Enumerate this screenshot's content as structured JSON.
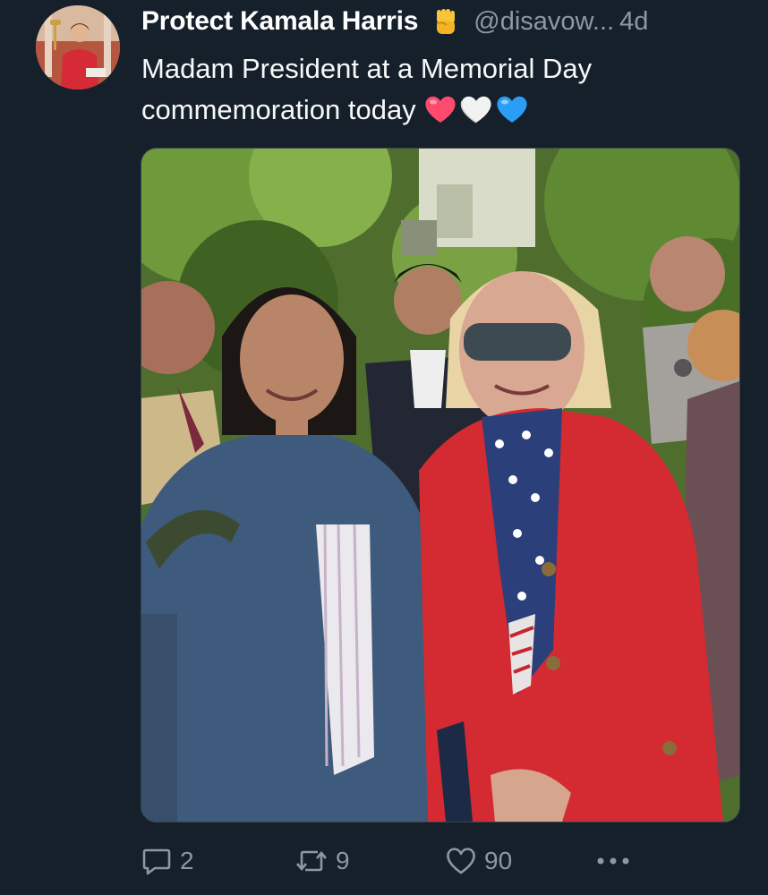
{
  "author": {
    "display_name": "Protect Kamala Harris",
    "badge_emoji": "raised-fist-emoji",
    "handle": "@disavow...",
    "time": "4d"
  },
  "tweet": {
    "text": "Madam President at a Memorial Day commemoration today",
    "emojis": [
      "red-heart",
      "white-heart",
      "blue-heart"
    ]
  },
  "media": {
    "description_icon": "photo"
  },
  "actions": {
    "reply_count": "2",
    "retweet_count": "9",
    "like_count": "90"
  },
  "colors": {
    "background": "#15202b",
    "secondary_text": "#8b98a5",
    "primary_text": "#f7f9f9"
  }
}
